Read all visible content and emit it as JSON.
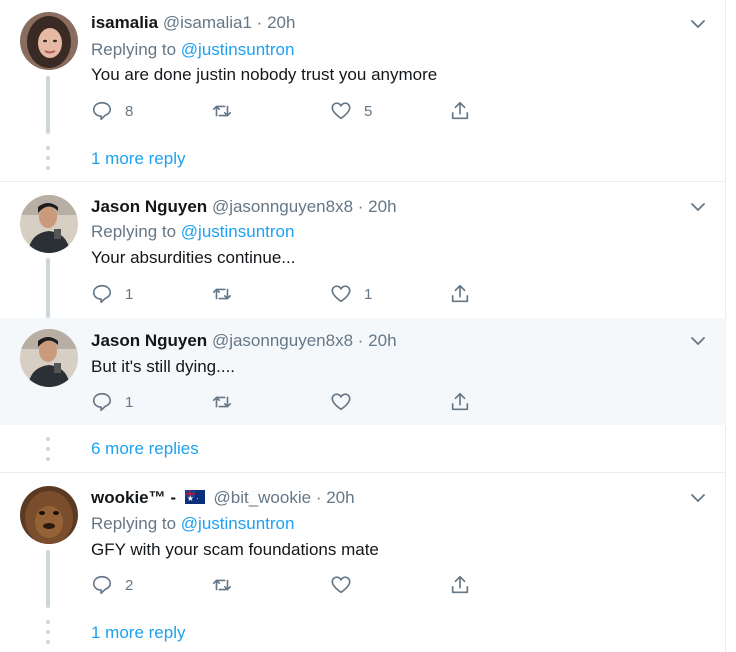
{
  "tweets": [
    {
      "name": "isamalia",
      "handle": "@isamalia1",
      "time": "20h",
      "replying_label": "Replying to",
      "replying_to": "@justinsuntron",
      "text": "You are done justin nobody trust you anymore",
      "replies": "8",
      "retweets": "",
      "likes": "5",
      "avatar": "avatar-woman-dark-hair"
    },
    {
      "name": "Jason Nguyen",
      "handle": "@jasonnguyen8x8",
      "time": "20h",
      "replying_label": "Replying to",
      "replying_to": "@justinsuntron",
      "text": "Your absurdities continue...",
      "replies": "1",
      "retweets": "",
      "likes": "1",
      "avatar": "avatar-man-phone"
    },
    {
      "name": "Jason Nguyen",
      "handle": "@jasonnguyen8x8",
      "time": "20h",
      "text": "But it's still dying....",
      "replies": "1",
      "retweets": "",
      "likes": "",
      "avatar": "avatar-man-phone"
    },
    {
      "name": "wookie™ -",
      "handle": "@bit_wookie",
      "time": "20h",
      "replying_label": "Replying to",
      "replying_to": "@justinsuntron",
      "text": "GFY with your scam foundations mate",
      "replies": "2",
      "retweets": "",
      "likes": "",
      "avatar": "avatar-wookiee"
    }
  ],
  "more_links": {
    "first": "1 more reply",
    "second": "6 more replies",
    "third": "1 more reply"
  },
  "separator": "·",
  "colors": {
    "link": "#1da1f2",
    "muted": "#657786",
    "highlight_bg": "#f5f8fa",
    "divider": "#e6ecf0"
  }
}
